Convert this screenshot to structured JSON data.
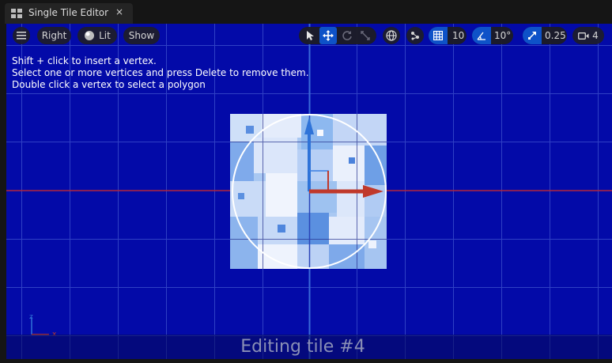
{
  "tab": {
    "title": "Single Tile Editor",
    "close_glyph": "×"
  },
  "toolbar": {
    "view_mode": "Right",
    "lighting": "Lit",
    "show": "Show",
    "grid_snap_value": "10",
    "rotation_snap_value": "10°",
    "scale_snap_value": "0.25",
    "camera_speed_value": "4",
    "icons": [
      "hamburger-menu-icon",
      "lit-sphere-icon",
      "select-arrow-icon",
      "translate-icon",
      "rotate-icon",
      "scale-icon",
      "world-local-icon",
      "surface-snap-icon",
      "grid-snap-icon",
      "angle-snap-icon",
      "scale-snap-icon",
      "camera-speed-icon"
    ]
  },
  "instructions": {
    "line1": "Shift + click to insert a vertex.",
    "line2": "Select one or more vertices and press Delete to remove them.",
    "line3": "Double click a vertex to select a polygon"
  },
  "status": {
    "text": "Editing tile #4"
  },
  "axes": {
    "z_label": "z",
    "x_label": "x"
  },
  "colors": {
    "viewport_bg": "#030aa8",
    "active_button": "#0e52c8",
    "x_axis": "#c0392b",
    "y_axis": "#2f73d8"
  }
}
